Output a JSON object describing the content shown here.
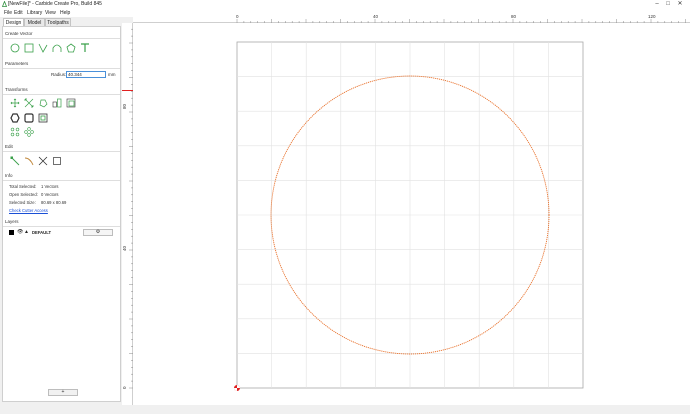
{
  "window": {
    "title": "[NewFile]* - Carbide Create Pro, Build 845",
    "minimize": "–",
    "maximize": "□",
    "close": "✕"
  },
  "menu": [
    "File",
    "Edit",
    "Library",
    "View",
    "Help"
  ],
  "tabs": [
    "Design",
    "Model",
    "Toolpaths"
  ],
  "active_tab": "Design",
  "sections": {
    "create_vector": "Create Vector",
    "parameters": "Parameters",
    "transforms": "Transforms",
    "edit": "Edit",
    "info": "Info",
    "layers": "Layers"
  },
  "create_vector_icons": [
    "circle-icon",
    "rectangle-icon",
    "polyline-icon",
    "curve-icon",
    "polygon-icon",
    "text-icon"
  ],
  "transform_icons": [
    "move-icon",
    "scale-icon",
    "rotate-icon",
    "mirror-icon",
    "align-icon",
    "offset-icon",
    "join-icon",
    "combine-icon",
    "array-icon",
    "circular-array-icon"
  ],
  "edit_icons": [
    "node-edit-icon",
    "trim-icon",
    "delete-icon",
    "select-icon"
  ],
  "parameters": {
    "radius_label": "Radius:",
    "radius_value": "40.344",
    "radius_unit": "mm"
  },
  "info": {
    "total_selected_label": "Total Selected:",
    "total_selected_value": "1 Vectors",
    "open_selected_label": "Open Selected:",
    "open_selected_value": "0 Vectors",
    "selected_size_label": "Selected Size:",
    "selected_size_value": "80.69 x 80.69",
    "check_link": "Check Cutter Access"
  },
  "layers": {
    "name": "DEFAULT",
    "settings_icon": "⚙",
    "add_button": "+"
  },
  "ruler": {
    "h_labels": [
      "0",
      "40",
      "80",
      "120"
    ],
    "v_labels": [
      "80",
      "40",
      "0"
    ]
  },
  "colors": {
    "vector_orange": "#e8702a",
    "icon_green": "#3aa04a",
    "origin_red": "#e02020",
    "ruler_marker": "#e02020"
  }
}
